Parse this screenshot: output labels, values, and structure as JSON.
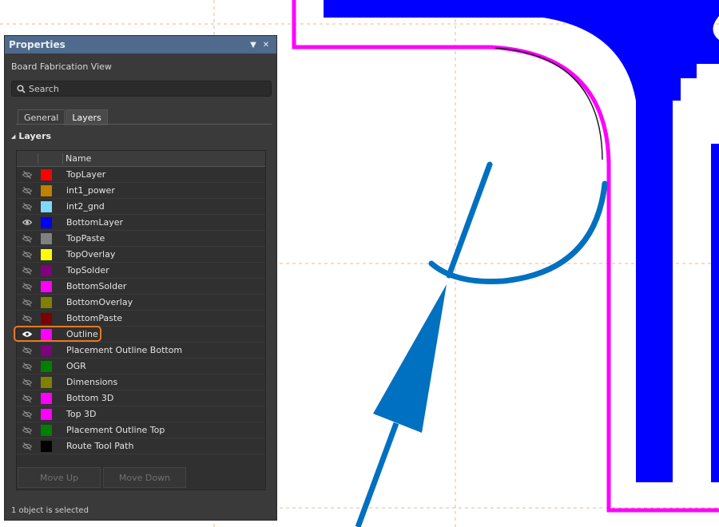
{
  "panel": {
    "title": "Properties",
    "subtitle": "Board Fabrication View",
    "search_placeholder": "Search",
    "tabs": [
      {
        "label": "General"
      },
      {
        "label": "Layers"
      }
    ],
    "active_tab": "Layers",
    "section_title": "Layers",
    "column_name": "Name",
    "layers": [
      {
        "name": "TopLayer",
        "color": "#ff0000",
        "visible": false
      },
      {
        "name": "int1_power",
        "color": "#c08000",
        "visible": false
      },
      {
        "name": "int2_gnd",
        "color": "#80d8ff",
        "visible": false
      },
      {
        "name": "BottomLayer",
        "color": "#0000ff",
        "visible": true
      },
      {
        "name": "TopPaste",
        "color": "#808080",
        "visible": false
      },
      {
        "name": "TopOverlay",
        "color": "#ffff00",
        "visible": false
      },
      {
        "name": "TopSolder",
        "color": "#800080",
        "visible": false
      },
      {
        "name": "BottomSolder",
        "color": "#ff00ff",
        "visible": false
      },
      {
        "name": "BottomOverlay",
        "color": "#808000",
        "visible": false
      },
      {
        "name": "BottomPaste",
        "color": "#800000",
        "visible": false
      },
      {
        "name": "Outline",
        "color": "#ff00ff",
        "visible": true,
        "selected": true
      },
      {
        "name": "Placement Outline Bottom",
        "color": "#800080",
        "visible": false
      },
      {
        "name": "OGR",
        "color": "#008000",
        "visible": false
      },
      {
        "name": "Dimensions",
        "color": "#808000",
        "visible": false
      },
      {
        "name": "Bottom 3D",
        "color": "#ff00ff",
        "visible": false
      },
      {
        "name": "Top 3D",
        "color": "#ff00ff",
        "visible": false
      },
      {
        "name": "Placement Outline Top",
        "color": "#008000",
        "visible": false
      },
      {
        "name": "Route Tool Path",
        "color": "#000000",
        "visible": false
      }
    ],
    "buttons": {
      "move_up": "Move Up",
      "move_down": "Move Down"
    },
    "status": "1 object is selected"
  },
  "canvas": {
    "colors": {
      "copper": "#0000ff",
      "outline": "#ff00ff",
      "dimension": "#0070c0",
      "guide": "#f3b58a"
    }
  }
}
